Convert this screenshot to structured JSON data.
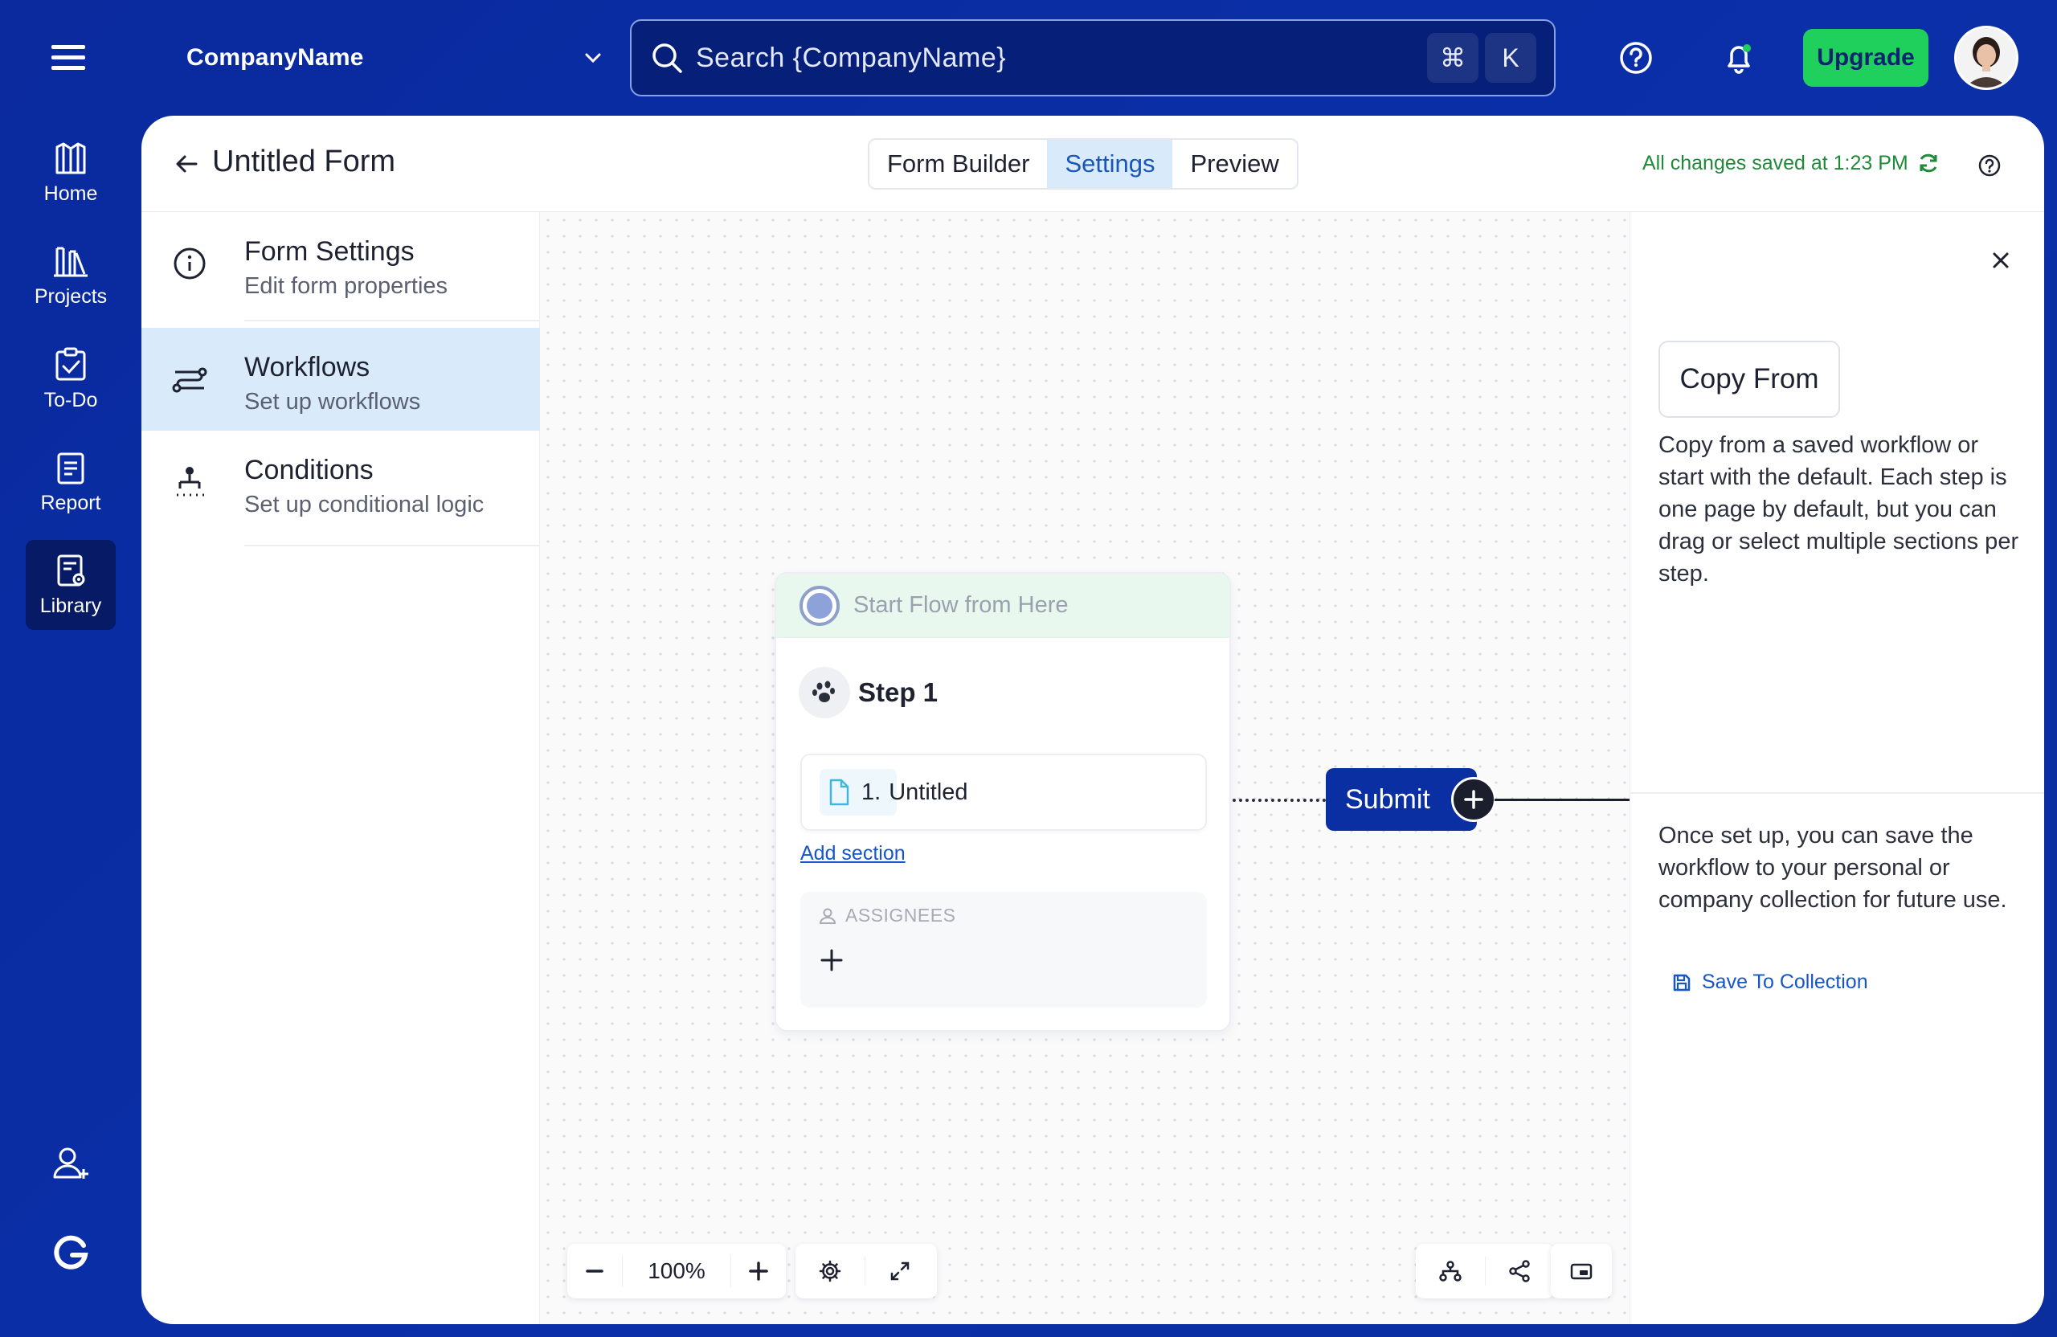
{
  "topbar": {
    "company_name": "CompanyName",
    "search_placeholder": "Search {CompanyName}",
    "shortcut_modifier": "⌘",
    "shortcut_key": "K",
    "upgrade_label": "Upgrade",
    "icons": [
      "menu-icon",
      "chevron-down-icon",
      "search-icon",
      "help-icon",
      "bell-icon",
      "avatar"
    ]
  },
  "rail": {
    "items": [
      {
        "label": "Home",
        "icon": "home-icon"
      },
      {
        "label": "Projects",
        "icon": "projects-icon"
      },
      {
        "label": "To-Do",
        "icon": "todo-icon"
      },
      {
        "label": "Report",
        "icon": "report-icon"
      },
      {
        "label": "Library",
        "icon": "library-icon",
        "active": true
      }
    ],
    "bottom_icons": [
      "add-user-icon",
      "g-logo-icon"
    ]
  },
  "header": {
    "title": "Untitled Form",
    "tabs": [
      {
        "label": "Form Builder"
      },
      {
        "label": "Settings",
        "active": true
      },
      {
        "label": "Preview"
      }
    ],
    "saved_status": "All changes saved at 1:23 PM"
  },
  "settings": {
    "items": [
      {
        "title": "Form Settings",
        "subtitle": "Edit form properties",
        "icon": "info-icon"
      },
      {
        "title": "Workflows",
        "subtitle": "Set up workflows",
        "icon": "workflow-icon",
        "active": true
      },
      {
        "title": "Conditions",
        "subtitle": "Set up conditional logic",
        "icon": "conditions-icon"
      }
    ]
  },
  "canvas": {
    "start_label": "Start Flow from Here",
    "step_title": "Step 1",
    "section_number": "1.",
    "section_name": "Untitled",
    "add_section": "Add section",
    "assignees_label": "ASSIGNEES",
    "submit_label": "Submit",
    "zoom": "100%"
  },
  "right_panel": {
    "copy_from_label": "Copy From",
    "copy_text": "Copy from a saved workflow or start with the default. Each step is one page by default, but you can drag or select multiple sections per step.",
    "save_text": "Once set up, you can save the workflow to your personal or company collection for future use.",
    "save_link": "Save To Collection"
  },
  "colors": {
    "brand_blue": "#0a2fa3",
    "upgrade_green": "#1fd05c",
    "saved_green": "#1e8a3a",
    "active_tab_bg": "#d9ebfb",
    "link_blue": "#1656c8"
  }
}
